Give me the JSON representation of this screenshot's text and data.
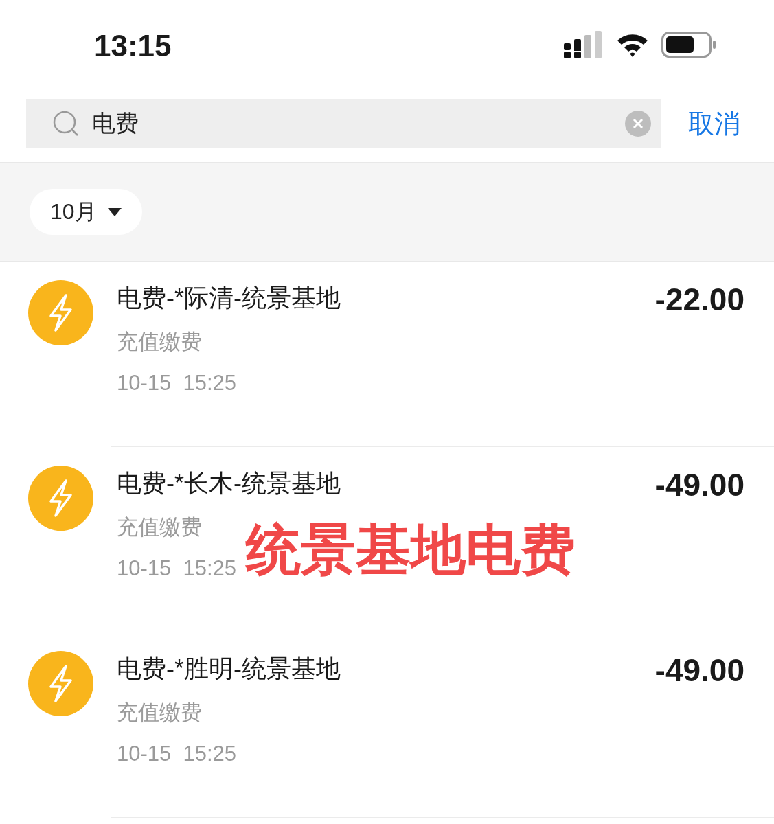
{
  "status_bar": {
    "time": "13:15"
  },
  "search": {
    "value": "电费",
    "cancel": "取消"
  },
  "filter": {
    "month": "10月"
  },
  "transactions": [
    {
      "title": "电费-*际清-统景基地",
      "category": "充值缴费",
      "time": "10-15  15:25",
      "amount": "-22.00"
    },
    {
      "title": "电费-*长木-统景基地",
      "category": "充值缴费",
      "time": "10-15  15:25",
      "amount": "-49.00"
    },
    {
      "title": "电费-*胜明-统景基地",
      "category": "充值缴费",
      "time": "10-15  15:25",
      "amount": "-49.00"
    }
  ],
  "annotation": "统景基地电费"
}
